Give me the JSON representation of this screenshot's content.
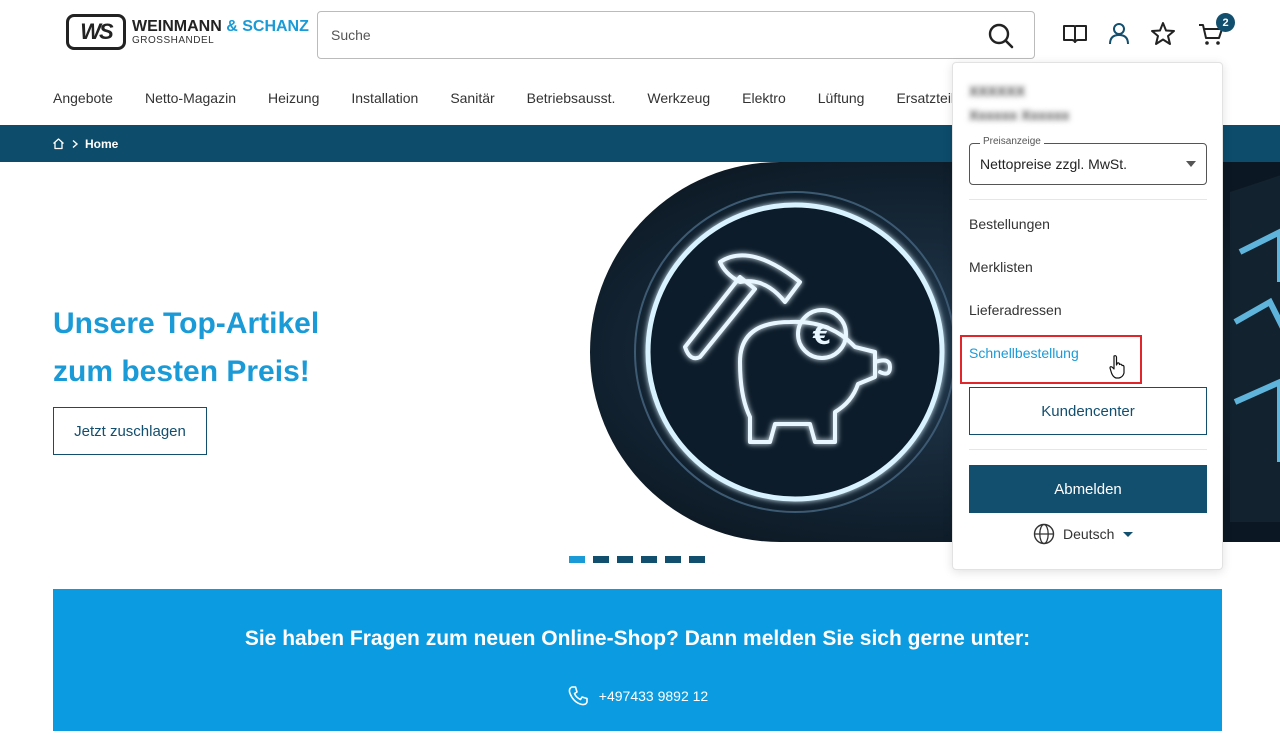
{
  "header": {
    "logo_mark": "WS",
    "logo_name": "WEINMANN",
    "logo_amp": "& SCHANZ",
    "logo_sub": "GROSSHANDEL",
    "search_placeholder": "Suche",
    "cart_count": "2"
  },
  "nav": {
    "items": [
      "Angebote",
      "Netto-Magazin",
      "Heizung",
      "Installation",
      "Sanitär",
      "Betriebsausst.",
      "Werkzeug",
      "Elektro",
      "Lüftung",
      "Ersatzteile"
    ]
  },
  "breadcrumb": {
    "home": "Home"
  },
  "hero": {
    "title_line1": "Unsere Top-Artikel",
    "title_line2": "zum besten Preis!",
    "button": "Jetzt zuschlagen",
    "slide_count": 6,
    "active_slide": 1
  },
  "info": {
    "text": "Sie haben Fragen zum neuen Online-Shop? Dann melden Sie sich gerne unter:",
    "phone": "+497433 9892 12"
  },
  "account_menu": {
    "blurred_line1": "XXXXXX",
    "blurred_line2": "Xxxxxx Xxxxxx",
    "price_label": "Preisanzeige",
    "price_value": "Nettopreise zzgl. MwSt.",
    "links": [
      "Bestellungen",
      "Merklisten",
      "Lieferadressen",
      "Schnellbestellung"
    ],
    "customer_center": "Kundencenter",
    "logout": "Abmelden",
    "language": "Deutsch"
  },
  "colors": {
    "brand_blue": "#1a9ad6",
    "dark_blue": "#124e6e",
    "banner_blue": "#0a9be0",
    "highlight_red": "#e0252b"
  }
}
